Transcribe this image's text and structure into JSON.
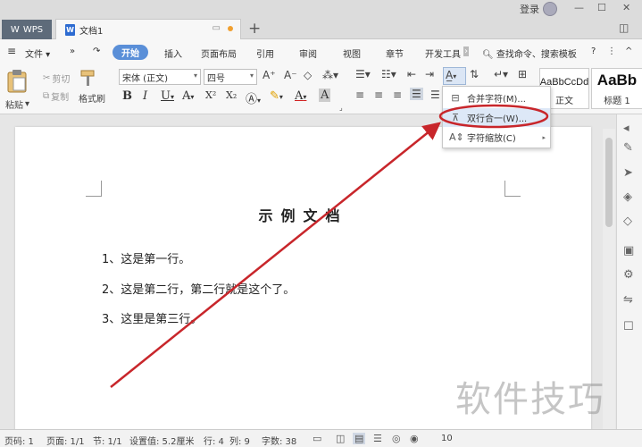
{
  "titlebar": {
    "app_tab": "WPS",
    "doc_tab": "文档1",
    "login": "登录",
    "new_tab": "+"
  },
  "menu": {
    "file": "文件",
    "start": "开始",
    "items": [
      "插入",
      "页面布局",
      "引用",
      "审阅",
      "视图",
      "章节",
      "开发工具"
    ],
    "search": "查找命令、搜索模板"
  },
  "ribbon": {
    "paste": "粘贴",
    "cut": "剪切",
    "copy": "复制",
    "format_painter": "格式刷",
    "font_name": "宋体 (正文)",
    "font_size": "四号",
    "styles": [
      {
        "sample": "AaBbCcDd",
        "label": "正文"
      },
      {
        "sample": "AaBb",
        "label": "标题 1"
      }
    ]
  },
  "dropdown": {
    "items": [
      {
        "label": "合并字符(M)...",
        "icon": "merge-chars-icon"
      },
      {
        "label": "双行合一(W)...",
        "icon": "two-lines-in-one-icon",
        "highlighted": true
      },
      {
        "label": "字符缩放(C)",
        "icon": "char-scale-icon",
        "submenu": true
      }
    ]
  },
  "document": {
    "title": "示例文档",
    "lines": [
      "1、这是第一行。",
      "2、这是第二行，第二行就是这个了。",
      "3、这里是第三行。"
    ]
  },
  "statusbar": {
    "page_no": "页码: 1",
    "pages": "页面: 1/1",
    "section": "节: 1/1",
    "setting": "设置值: 5.2厘米",
    "row": "行: 4",
    "col": "列: 9",
    "words": "字数: 38",
    "zoom": "10"
  },
  "watermark": "软件技巧",
  "colors": {
    "accent": "#5a8fd8",
    "annotation_red": "#c8262b",
    "highlight": "#dde8f7"
  }
}
